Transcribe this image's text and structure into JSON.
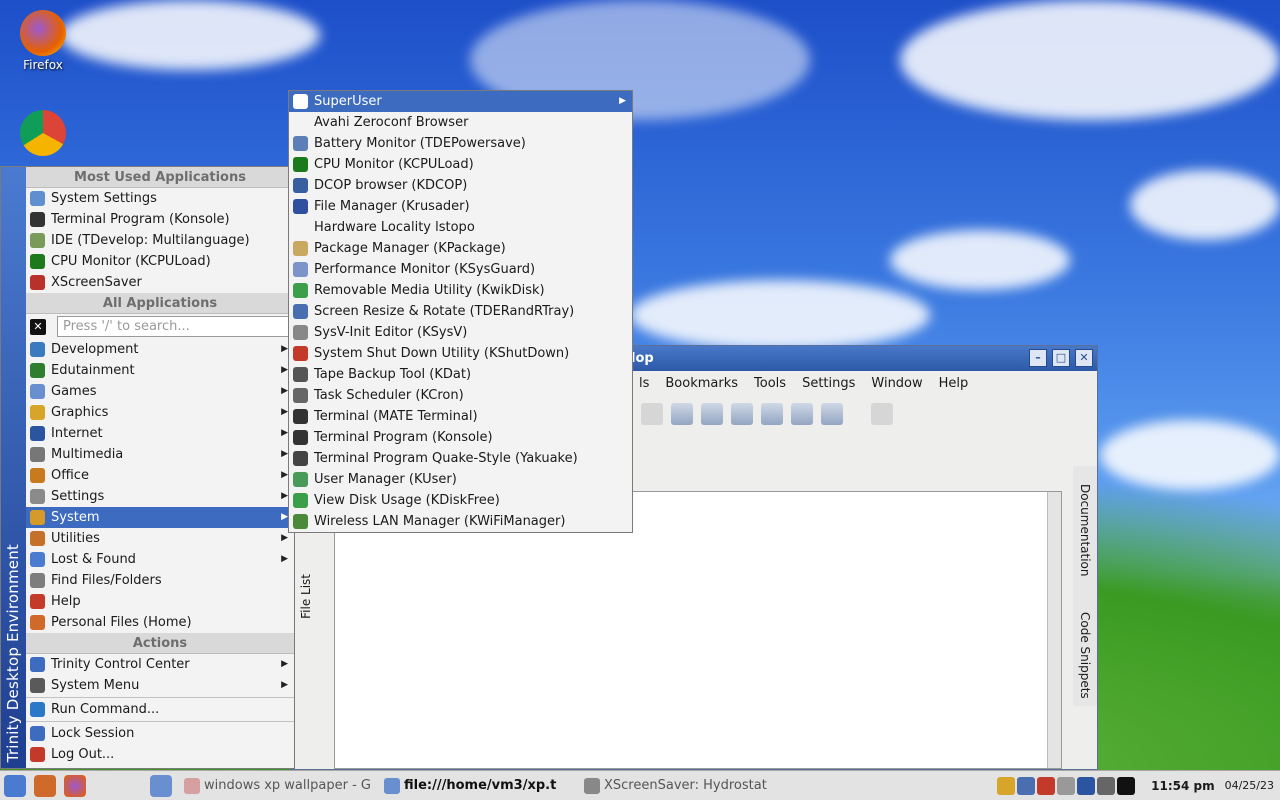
{
  "desktop": {
    "icons": [
      {
        "label": "Firefox"
      },
      {
        "label": "Google Chrome"
      }
    ]
  },
  "app_window": {
    "title": "lop",
    "menus": [
      "ls",
      "Bookmarks",
      "Tools",
      "Settings",
      "Window",
      "Help"
    ],
    "left_tabs": [
      "File List",
      "Fil"
    ],
    "right_tabs": [
      "Documentation",
      "Code Snippets"
    ]
  },
  "kmenu": {
    "sidebar_label": "Trinity Desktop Environment",
    "most_used_header": "Most Used Applications",
    "most_used": [
      {
        "label": "System Settings",
        "icon": "settings-icon",
        "color": "#5f8fcf"
      },
      {
        "label": "Terminal Program (Konsole)",
        "icon": "terminal-icon",
        "color": "#333333"
      },
      {
        "label": "IDE (TDevelop: Multilanguage)",
        "icon": "ide-icon",
        "color": "#7a9a5a"
      },
      {
        "label": "CPU Monitor (KCPULoad)",
        "icon": "cpu-icon",
        "color": "#1c7a1c"
      },
      {
        "label": "XScreenSaver",
        "icon": "screensaver-icon",
        "color": "#b8322b"
      }
    ],
    "all_apps_header": "All Applications",
    "search_placeholder": "Press '/' to search...",
    "categories": [
      {
        "label": "Development",
        "icon": "development-icon",
        "color": "#3a7bbf"
      },
      {
        "label": "Edutainment",
        "icon": "edutainment-icon",
        "color": "#2f7d2f"
      },
      {
        "label": "Games",
        "icon": "games-icon",
        "color": "#6a8fd1"
      },
      {
        "label": "Graphics",
        "icon": "graphics-icon",
        "color": "#d6a52a"
      },
      {
        "label": "Internet",
        "icon": "internet-icon",
        "color": "#2b55a0"
      },
      {
        "label": "Multimedia",
        "icon": "multimedia-icon",
        "color": "#777777"
      },
      {
        "label": "Office",
        "icon": "office-icon",
        "color": "#c87a1f"
      },
      {
        "label": "Settings",
        "icon": "wrench-icon",
        "color": "#8a8a8a"
      },
      {
        "label": "System",
        "icon": "system-icon",
        "color": "#d69a2a",
        "selected": true
      },
      {
        "label": "Utilities",
        "icon": "utilities-icon",
        "color": "#c46f2a"
      },
      {
        "label": "Lost & Found",
        "icon": "lost-found-icon",
        "color": "#4a7bd0"
      }
    ],
    "plain_items": [
      {
        "label": "Find Files/Folders",
        "icon": "find-icon",
        "color": "#7d7d7d"
      },
      {
        "label": "Help",
        "icon": "help-icon",
        "color": "#c43a2a"
      },
      {
        "label": "Personal Files (Home)",
        "icon": "home-icon",
        "color": "#d06a2a"
      }
    ],
    "actions_header": "Actions",
    "actions": [
      {
        "label": "Trinity Control Center",
        "icon": "control-center-icon",
        "color": "#3d6bbf",
        "submenu": true
      },
      {
        "label": "System Menu",
        "icon": "system-menu-icon",
        "color": "#5a5a5a",
        "submenu": true
      }
    ],
    "run": {
      "label": "Run Command...",
      "icon": "run-icon",
      "color": "#2d77c9"
    },
    "session": [
      {
        "label": "Lock Session",
        "icon": "lock-icon",
        "color": "#3d6bbf"
      },
      {
        "label": "Log Out...",
        "icon": "logout-icon",
        "color": "#c43a2a"
      }
    ]
  },
  "system_submenu": [
    {
      "label": "SuperUser",
      "icon": "superuser-icon",
      "color": "#ffffff",
      "submenu": true,
      "selected": true
    },
    {
      "label": "Avahi Zeroconf Browser",
      "icon": "",
      "color": ""
    },
    {
      "label": "Battery Monitor (TDEPowersave)",
      "icon": "battery-icon",
      "color": "#5d7fb8"
    },
    {
      "label": "CPU Monitor (KCPULoad)",
      "icon": "cpu-icon",
      "color": "#1c7a1c"
    },
    {
      "label": "DCOP browser (KDCOP)",
      "icon": "dcop-icon",
      "color": "#3a5fa0"
    },
    {
      "label": "File Manager (Krusader)",
      "icon": "krusader-icon",
      "color": "#2f4f9f"
    },
    {
      "label": "Hardware Locality lstopo",
      "icon": "",
      "color": ""
    },
    {
      "label": "Package Manager (KPackage)",
      "icon": "package-icon",
      "color": "#c9a860"
    },
    {
      "label": "Performance Monitor (KSysGuard)",
      "icon": "ksysguard-icon",
      "color": "#7d93c9"
    },
    {
      "label": "Removable Media Utility (KwikDisk)",
      "icon": "kwikdisk-icon",
      "color": "#3d9e4a"
    },
    {
      "label": "Screen Resize & Rotate (TDERandRTray)",
      "icon": "randr-icon",
      "color": "#4a6fb0"
    },
    {
      "label": "SysV-Init Editor (KSysV)",
      "icon": "ksysv-icon",
      "color": "#888888"
    },
    {
      "label": "System Shut Down Utility (KShutDown)",
      "icon": "shutdown-icon",
      "color": "#c43a2a"
    },
    {
      "label": "Tape Backup Tool (KDat)",
      "icon": "kdat-icon",
      "color": "#555555"
    },
    {
      "label": "Task Scheduler (KCron)",
      "icon": "kcron-icon",
      "color": "#666666"
    },
    {
      "label": "Terminal (MATE Terminal)",
      "icon": "terminal-icon",
      "color": "#333333"
    },
    {
      "label": "Terminal Program (Konsole)",
      "icon": "terminal-icon",
      "color": "#333333"
    },
    {
      "label": "Terminal Program Quake-Style (Yakuake)",
      "icon": "yakuake-icon",
      "color": "#444444"
    },
    {
      "label": "User Manager (KUser)",
      "icon": "kuser-icon",
      "color": "#4a9a5a"
    },
    {
      "label": "View Disk Usage (KDiskFree)",
      "icon": "kdiskfree-icon",
      "color": "#3d9e4a"
    },
    {
      "label": "Wireless LAN Manager (KWiFiManager)",
      "icon": "wifi-icon",
      "color": "#4a8a3a"
    }
  ],
  "taskbar": {
    "tasks": [
      {
        "label": "windows xp wallpaper - G",
        "icon": "chrome-icon",
        "color": "#d6a0a0"
      },
      {
        "label": "file:///home/vm3/xp.t",
        "icon": "kdevelop-icon",
        "color": "#6a8fd1",
        "active": true
      },
      {
        "label": "XScreenSaver: Hydrostat",
        "icon": "x-icon",
        "color": "#888888"
      }
    ],
    "clock": "11:54 pm",
    "date": "04/25/23"
  }
}
